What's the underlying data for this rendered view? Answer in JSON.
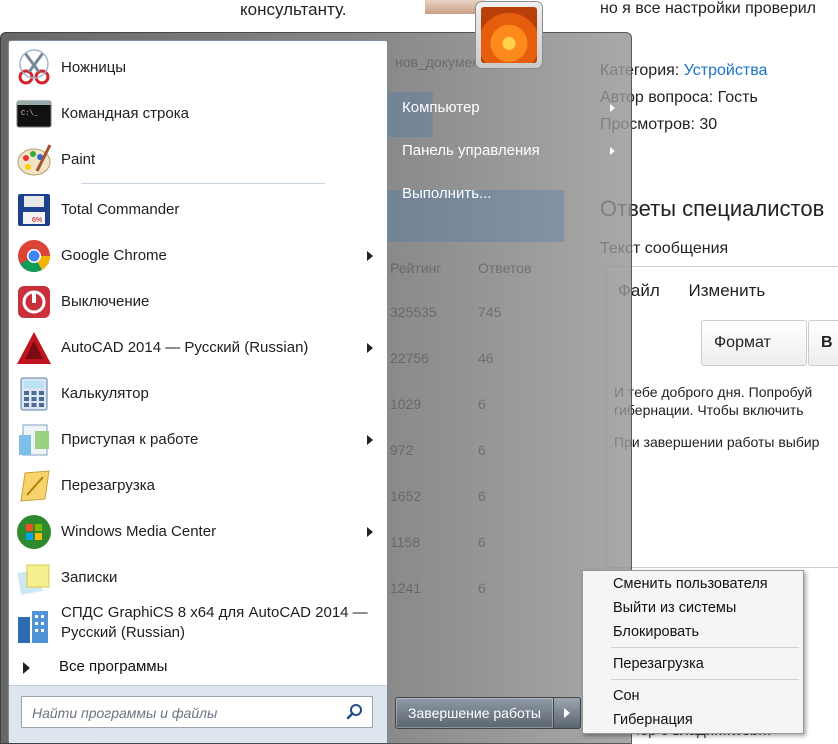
{
  "background_page": {
    "top_left_text": "консультанту.",
    "top_right_text": "но я все настройки проверил",
    "category_label": "Категория:",
    "category_value": "Устройства",
    "author_line": "Автор вопроса: Гость",
    "views_line": "Просмотров: 30",
    "answers_heading": "Ответы специалистов",
    "message_label": "Текст сообщения",
    "editor_menu": [
      "Файл",
      "Изменить"
    ],
    "format_label": "Формат",
    "bold_label": "B",
    "editor_line1": "И тебе доброго дня. Попробуй",
    "editor_line2": "гибернации. Чтобы включить",
    "editor_line3": "При завершении работы выбир",
    "footer_text": "чер с влади....webm",
    "ghost_top": "нов_документов",
    "ghost_header": [
      "Рейтинг",
      "Ответов"
    ],
    "ghost_rows": [
      [
        "325535",
        "745"
      ],
      [
        "22756",
        "46"
      ],
      [
        "1029",
        "6"
      ],
      [
        "972",
        "6"
      ],
      [
        "1652",
        "6"
      ],
      [
        "1158",
        "6"
      ],
      [
        "1241",
        "6"
      ]
    ]
  },
  "start_menu": {
    "programs": [
      {
        "label": "Ножницы",
        "icon": "scissors-icon",
        "has_submenu": false
      },
      {
        "label": "Командная строка",
        "icon": "command-prompt-icon",
        "has_submenu": false
      },
      {
        "label": "Paint",
        "icon": "paint-icon",
        "has_submenu": false
      },
      {
        "label": "Total Commander",
        "icon": "total-commander-icon",
        "has_submenu": false
      },
      {
        "label": "Google Chrome",
        "icon": "chrome-icon",
        "has_submenu": true
      },
      {
        "label": "Выключение",
        "icon": "power-off-icon",
        "has_submenu": false
      },
      {
        "label": "AutoCAD 2014 — Русский (Russian)",
        "icon": "autocad-icon",
        "has_submenu": true
      },
      {
        "label": "Калькулятор",
        "icon": "calculator-icon",
        "has_submenu": false
      },
      {
        "label": "Приступая к работе",
        "icon": "getting-started-icon",
        "has_submenu": true
      },
      {
        "label": "Перезагрузка",
        "icon": "restart-icon",
        "has_submenu": false
      },
      {
        "label": "Windows Media Center",
        "icon": "media-center-icon",
        "has_submenu": true
      },
      {
        "label": "Записки",
        "icon": "sticky-notes-icon",
        "has_submenu": false
      },
      {
        "label": "СПДС GraphiCS 8 x64 для AutoCAD 2014 —",
        "label2": "Русский (Russian)",
        "icon": "spds-graphics-icon",
        "has_submenu": false
      }
    ],
    "all_programs": "Все программы",
    "search_placeholder": "Найти программы и файлы",
    "right_items": [
      {
        "label": "Компьютер",
        "has_submenu": true
      },
      {
        "label": "Панель управления",
        "has_submenu": true
      },
      {
        "label": "Выполнить...",
        "has_submenu": false
      }
    ],
    "shutdown_label": "Завершение работы",
    "power_menu": {
      "group1": [
        "Сменить пользователя",
        "Выйти из системы",
        "Блокировать"
      ],
      "group2": [
        "Перезагрузка"
      ],
      "group3": [
        "Сон",
        "Гибернация"
      ]
    }
  },
  "colors": {
    "link": "#1a73c7",
    "menu_text_right": "#ffffff"
  }
}
